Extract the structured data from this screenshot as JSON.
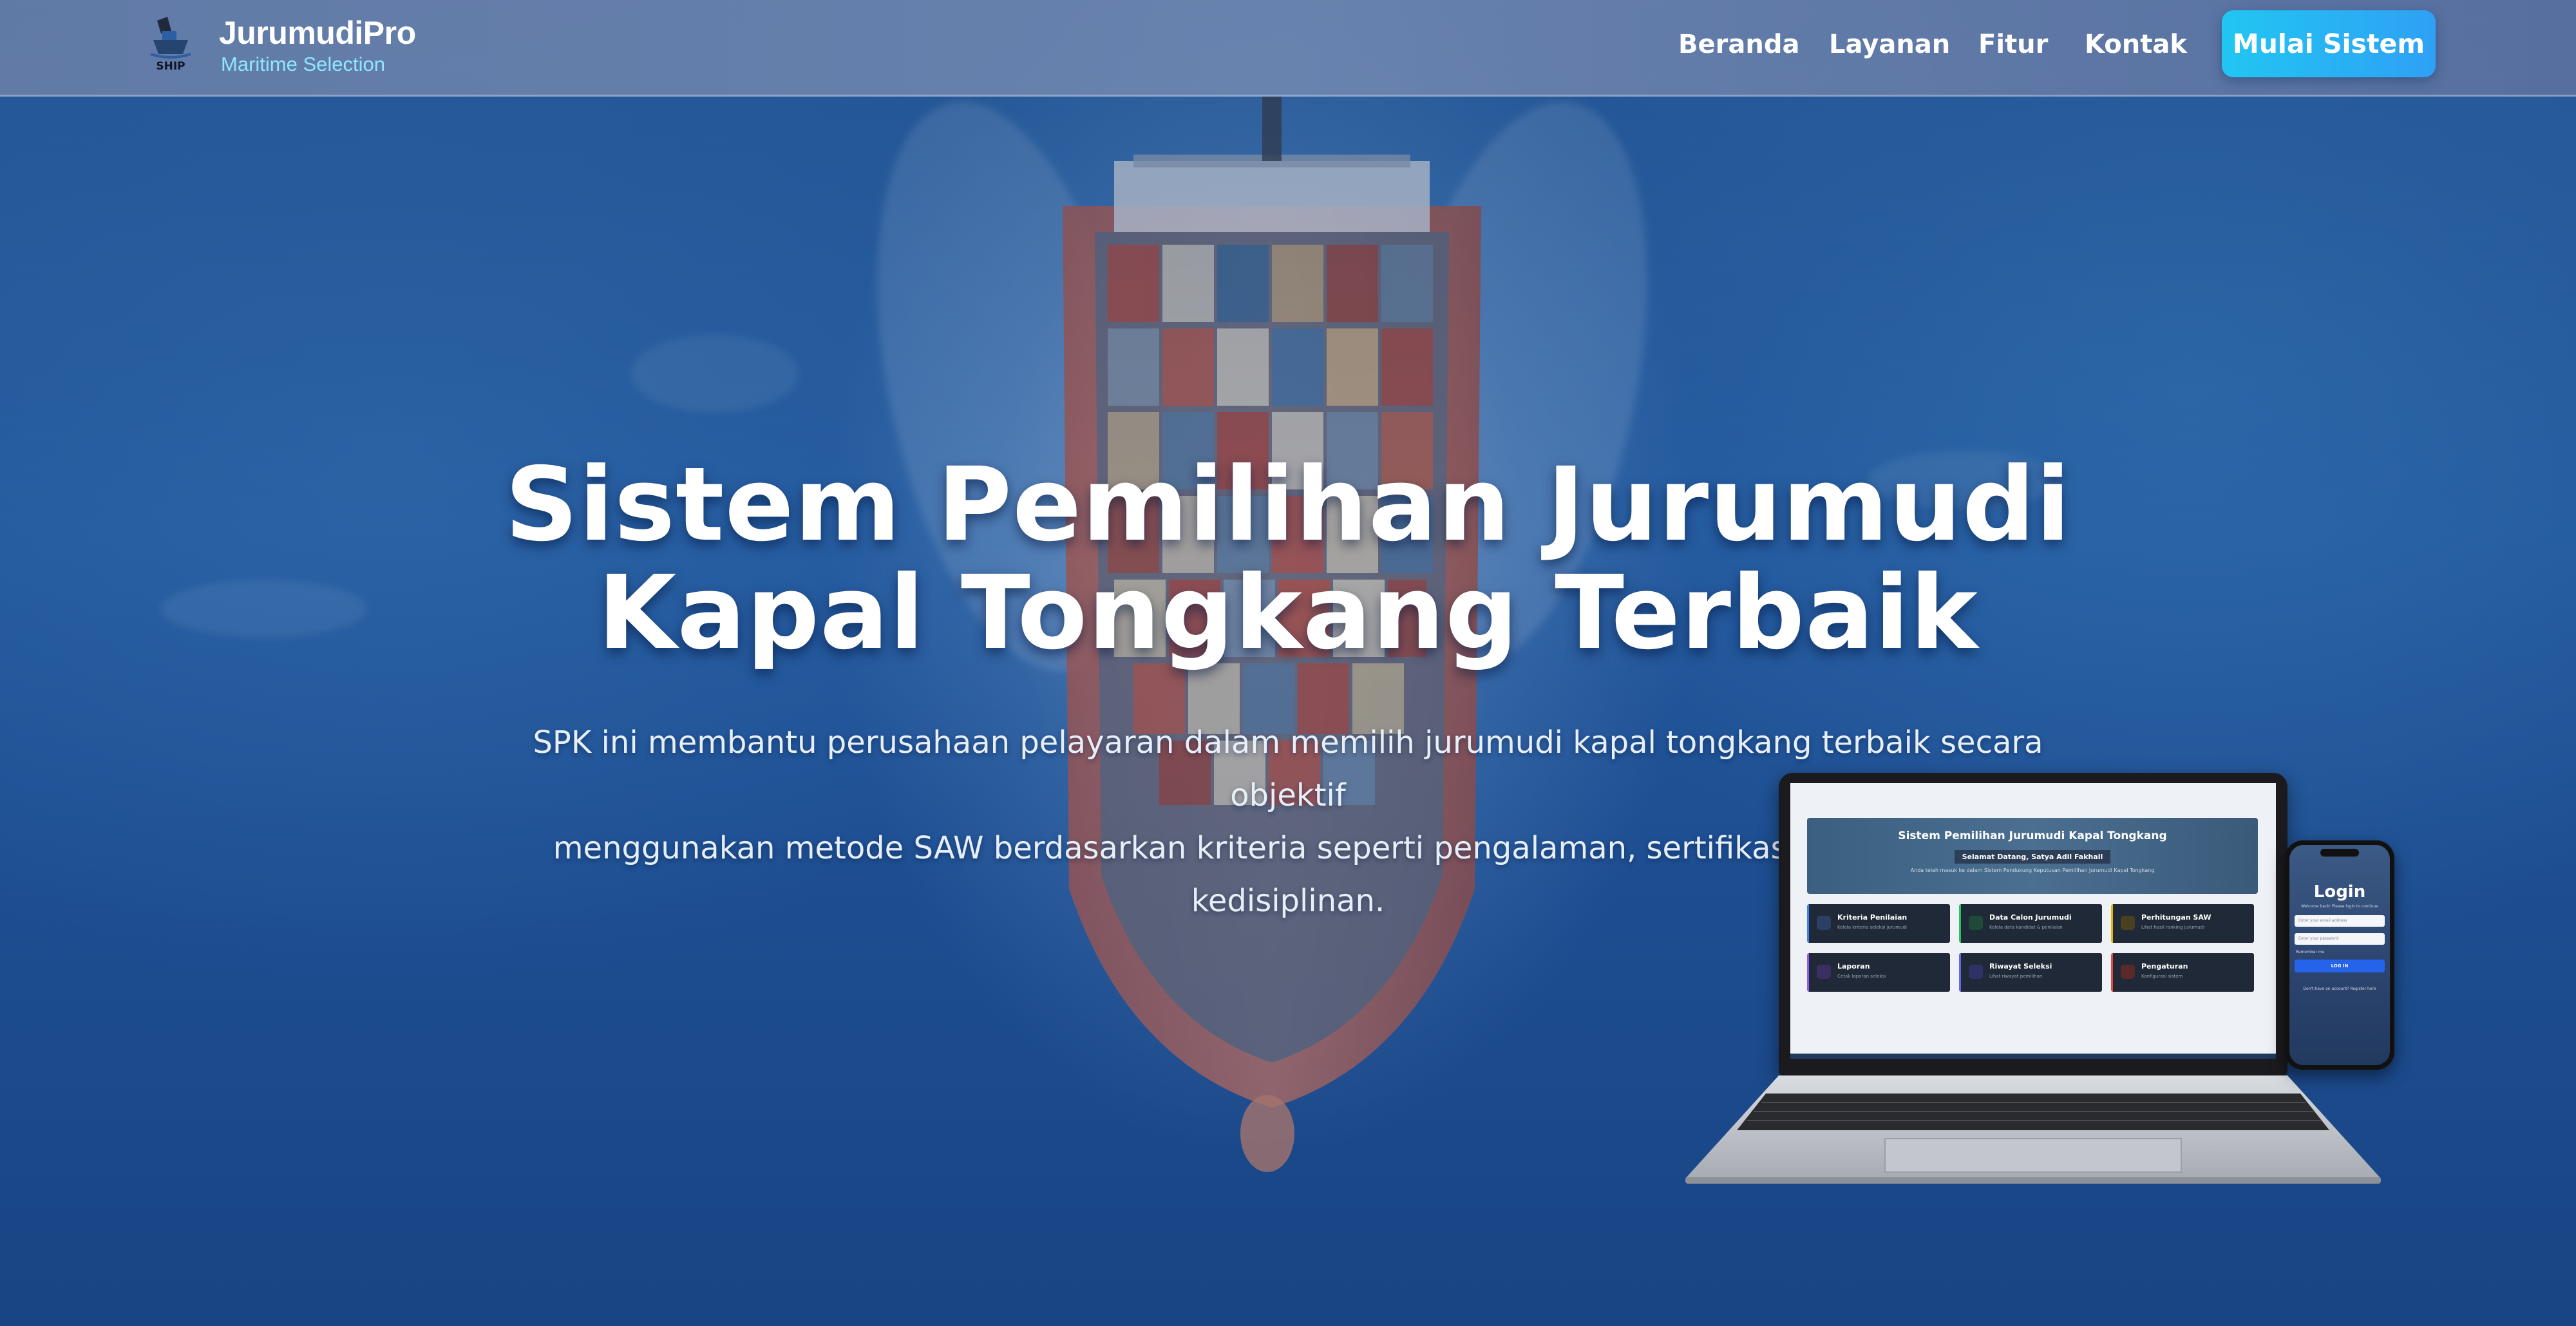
{
  "brand": {
    "name": "JurumudiPro",
    "tagline": "Maritime Selection",
    "logo_text": "SHIP"
  },
  "nav": {
    "items": [
      {
        "label": "Beranda"
      },
      {
        "label": "Layanan"
      },
      {
        "label": "Fitur"
      },
      {
        "label": "Kontak"
      }
    ],
    "cta_label": "Mulai Sistem"
  },
  "hero": {
    "title_line1": "Sistem Pemilihan Jurumudi",
    "title_line2": "Kapal Tongkang Terbaik",
    "subtitle_line1": "SPK ini membantu perusahaan pelayaran dalam memilih jurumudi kapal tongkang terbaik secara objektif",
    "subtitle_line2": "menggunakan metode SAW berdasarkan kriteria seperti pengalaman, sertifikasi, keahlian, dan",
    "subtitle_line3": "kedisiplinan."
  },
  "laptop_preview": {
    "title": "Sistem Pemilihan Jurumudi Kapal Tongkang",
    "welcome": "Selamat Datang, Satya Adil Fakhall",
    "description": "Anda telah masuk ke dalam Sistem Pendukung Keputusan Pemilihan Jurumudi Kapal Tongkang",
    "cards": [
      {
        "title": "Kriteria Penilaian",
        "subtitle": "Kelola kriteria seleksi jurumudi",
        "color": "#3b82f6"
      },
      {
        "title": "Data Calon Jurumudi",
        "subtitle": "Kelola data kandidat & penilaian",
        "color": "#22c55e"
      },
      {
        "title": "Perhitungan SAW",
        "subtitle": "Lihat hasil ranking jurumudi",
        "color": "#eab308"
      },
      {
        "title": "Laporan",
        "subtitle": "Cetak laporan seleksi",
        "color": "#8b5cf6"
      },
      {
        "title": "Riwayat Seleksi",
        "subtitle": "Lihat riwayat pemilihan",
        "color": "#6366f1"
      },
      {
        "title": "Pengaturan",
        "subtitle": "Konfigurasi sistem",
        "color": "#ef4444"
      }
    ]
  },
  "phone_preview": {
    "title": "Login",
    "subtitle": "Welcome back! Please login to continue",
    "email_placeholder": "Enter your email address",
    "password_placeholder": "Enter your password",
    "remember_label": "Remember me",
    "button_label": "LOG IN",
    "register_text": "Don't have an account? Register here"
  },
  "colors": {
    "accent": "#21c6f2",
    "tagline": "#8fe6ff",
    "navbar": "#7284aa"
  }
}
